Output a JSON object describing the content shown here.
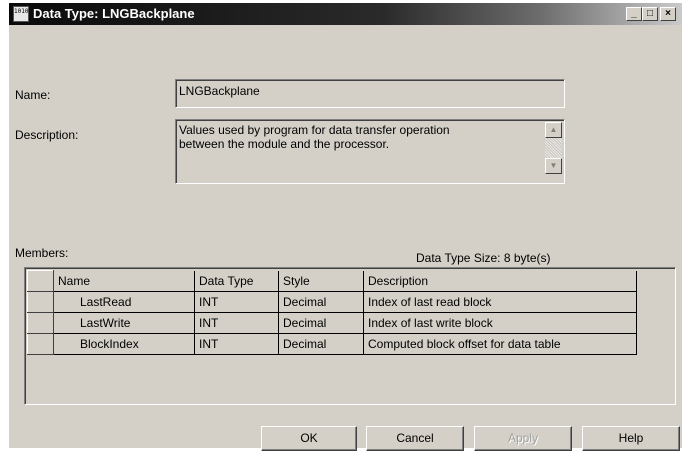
{
  "window": {
    "title": "Data Type: LNGBackplane",
    "icon_label": "1010",
    "controls": {
      "minimize": "_",
      "maximize": "□",
      "close": "×"
    }
  },
  "form": {
    "name_label": "Name:",
    "name_value": "LNGBackplane",
    "description_label": "Description:",
    "description_value": "Values used by program for data transfer operation\nbetween the module and the processor.",
    "members_label": "Members:",
    "data_type_size": "Data Type Size: 8 byte(s)"
  },
  "members": {
    "columns": [
      "Name",
      "Data Type",
      "Style",
      "Description"
    ],
    "rows": [
      {
        "name": "LastRead",
        "data_type": "INT",
        "style": "Decimal",
        "description": "Index of last read block"
      },
      {
        "name": "LastWrite",
        "data_type": "INT",
        "style": "Decimal",
        "description": "Index of last write block"
      },
      {
        "name": "BlockIndex",
        "data_type": "INT",
        "style": "Decimal",
        "description": "Computed block offset for data table"
      }
    ]
  },
  "buttons": {
    "ok": "OK",
    "cancel": "Cancel",
    "apply": "Apply",
    "help": "Help"
  },
  "scrollbar": {
    "up": "▲",
    "down": "▼"
  }
}
